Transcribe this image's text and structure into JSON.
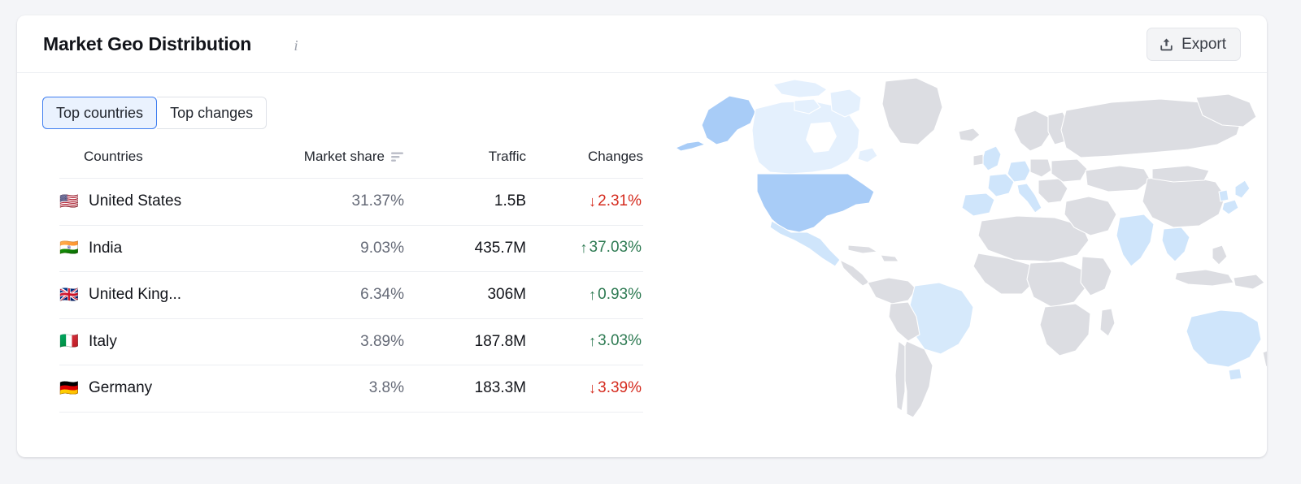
{
  "card": {
    "title": "Market Geo Distribution",
    "info_icon": "info-icon",
    "export": {
      "label": "Export",
      "icon": "upload-icon"
    }
  },
  "tabs": [
    {
      "label": "Top countries",
      "active": true
    },
    {
      "label": "Top changes",
      "active": false
    }
  ],
  "table": {
    "headers": {
      "country": "Countries",
      "share": "Market share",
      "traffic": "Traffic",
      "changes": "Changes"
    },
    "sort_icon": "sort-descending-icon",
    "rows": [
      {
        "flag": "🇺🇸",
        "country": "United States",
        "share": "31.37%",
        "traffic": "1.5B",
        "change": "2.31%",
        "direction": "down",
        "arrow": "↓"
      },
      {
        "flag": "🇮🇳",
        "country": "India",
        "share": "9.03%",
        "traffic": "435.7M",
        "change": "37.03%",
        "direction": "up",
        "arrow": "↑"
      },
      {
        "flag": "🇬🇧",
        "country": "United King...",
        "share": "6.34%",
        "traffic": "306M",
        "change": "0.93%",
        "direction": "up",
        "arrow": "↑"
      },
      {
        "flag": "🇮🇹",
        "country": "Italy",
        "share": "3.89%",
        "traffic": "187.8M",
        "change": "3.03%",
        "direction": "up",
        "arrow": "↑"
      },
      {
        "flag": "🇩🇪",
        "country": "Germany",
        "share": "3.8%",
        "traffic": "183.3M",
        "change": "3.39%",
        "direction": "down",
        "arrow": "↓"
      }
    ]
  },
  "map": {
    "name": "world-choropleth-map",
    "colors": {
      "no_data": "#dcdde2",
      "low": "#e4f0fd",
      "medium": "#cfe5fb",
      "high": "#a8ccf7",
      "border": "#ffffff"
    }
  },
  "colors": {
    "page_background": "#f4f5f8",
    "card_background": "#ffffff",
    "accent": "#3f7ef0",
    "positive": "#2d7a52",
    "negative": "#d52b1e",
    "muted_text": "#656a77"
  },
  "chart_data": {
    "type": "table",
    "title": "Market Geo Distribution",
    "categories": [
      "United States",
      "India",
      "United King...",
      "Italy",
      "Germany"
    ],
    "series": [
      {
        "name": "Market share",
        "values": [
          31.37,
          9.03,
          6.34,
          3.89,
          3.8
        ],
        "unit": "%"
      },
      {
        "name": "Traffic",
        "values": [
          "1.5B",
          "435.7M",
          "306M",
          "187.8M",
          "183.3M"
        ]
      },
      {
        "name": "Changes",
        "values": [
          -2.31,
          37.03,
          0.93,
          3.03,
          -3.39
        ],
        "unit": "%"
      }
    ],
    "legend": "none",
    "grid": false
  }
}
